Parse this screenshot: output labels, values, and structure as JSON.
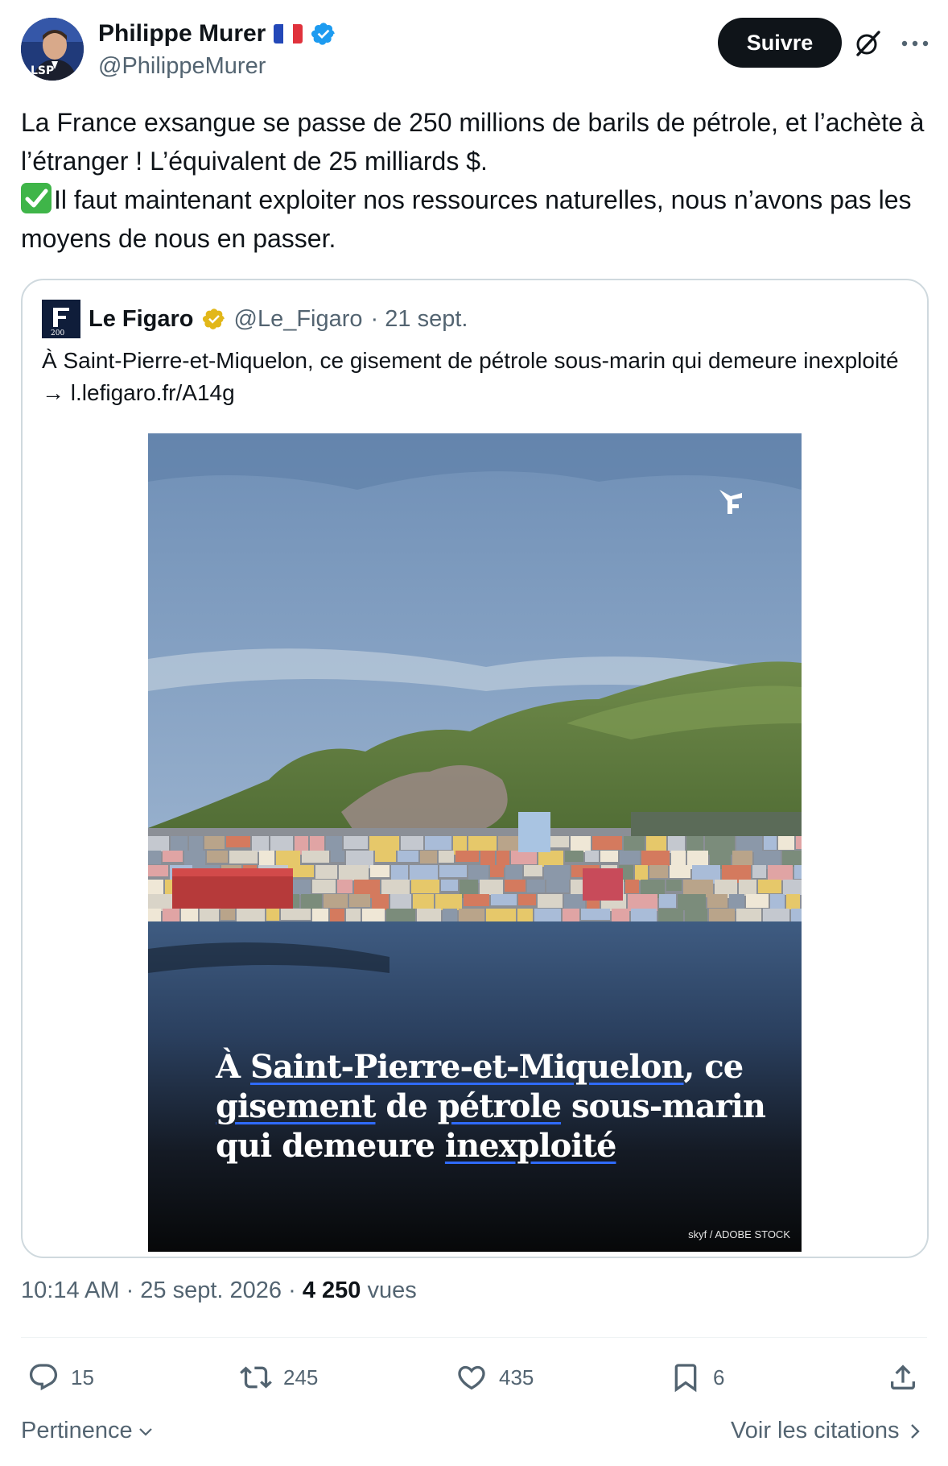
{
  "author": {
    "name": "Philippe Murer",
    "handle": "@PhilippeMurer",
    "follow_label": "Suivre"
  },
  "tweet": {
    "line1": "La France exsangue se passe de 250 millions de barils de pétrole, et l’achète à l’étranger ! L’équivalent de 25 milliards $.",
    "line2": "Il faut maintenant exploiter nos ressources naturelles, nous n’avons pas les moyens de nous en passer."
  },
  "quote": {
    "name": "Le Figaro",
    "handle": "@Le_Figaro",
    "date": "· 21 sept.",
    "text": "À Saint-Pierre-et-Miquelon, ce gisement de pétrole sous-marin qui demeure inexploité → l.lefigaro.fr/A14g",
    "image": {
      "headline_parts": [
        "À ",
        "Saint-Pierre-et-Miquelon",
        ", ce ",
        "gisement",
        " de ",
        "pétrole",
        " sous-marin qui demeure ",
        "inexploité"
      ],
      "credit": "skyf / ADOBE STOCK"
    }
  },
  "meta": {
    "time": "10:14 AM · 25 sept. 2026 · ",
    "views_count": "4 250",
    "views_label": " vues"
  },
  "actions": {
    "replies": "15",
    "reposts": "245",
    "likes": "435",
    "bookmarks": "6"
  },
  "footer": {
    "sort_label": "Pertinence",
    "quotes_link": "Voir les citations"
  },
  "colors": {
    "accent_verified": "#1d9bf0",
    "gold_verified": "#e2b719",
    "text_secondary": "#536471",
    "button_dark": "#0f1419"
  }
}
